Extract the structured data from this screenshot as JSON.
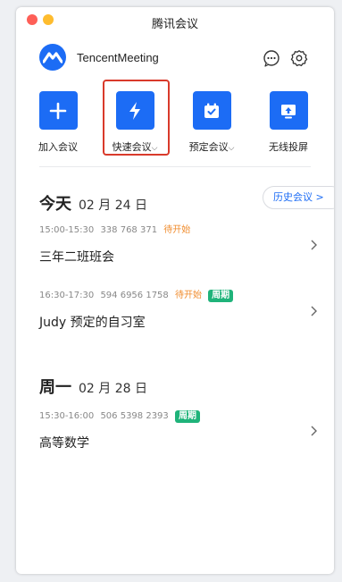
{
  "window": {
    "title": "腾讯会议"
  },
  "brand": {
    "name": "TencentMeeting"
  },
  "colors": {
    "accent": "#1c6cf5",
    "pending": "#f08c2e",
    "periodic_badge": "#1fb37a",
    "highlight_box": "#d93a2b"
  },
  "actions": [
    {
      "label": "加入会议",
      "icon": "plus-icon"
    },
    {
      "label": "快速会议",
      "icon": "lightning-icon",
      "has_dropdown": true,
      "highlighted": true
    },
    {
      "label": "预定会议",
      "icon": "calendar-check-icon",
      "has_dropdown": true
    },
    {
      "label": "无线投屏",
      "icon": "screen-cast-icon"
    }
  ],
  "history_button": {
    "label": "历史会议"
  },
  "days": [
    {
      "day": "今天",
      "date": "02 月 24 日",
      "meetings": [
        {
          "time": "15:00-15:30",
          "id": "338 768 371",
          "status": "待开始",
          "badge": "",
          "title": "三年二班班会"
        },
        {
          "time": "16:30-17:30",
          "id": "594 6956 1758",
          "status": "待开始",
          "badge": "周期",
          "title": "Judy 预定的自习室"
        }
      ]
    },
    {
      "day": "周一",
      "date": "02 月 28 日",
      "meetings": [
        {
          "time": "15:30-16:00",
          "id": "506 5398 2393",
          "status": "",
          "badge": "周期",
          "title": "高等数学"
        }
      ]
    }
  ]
}
